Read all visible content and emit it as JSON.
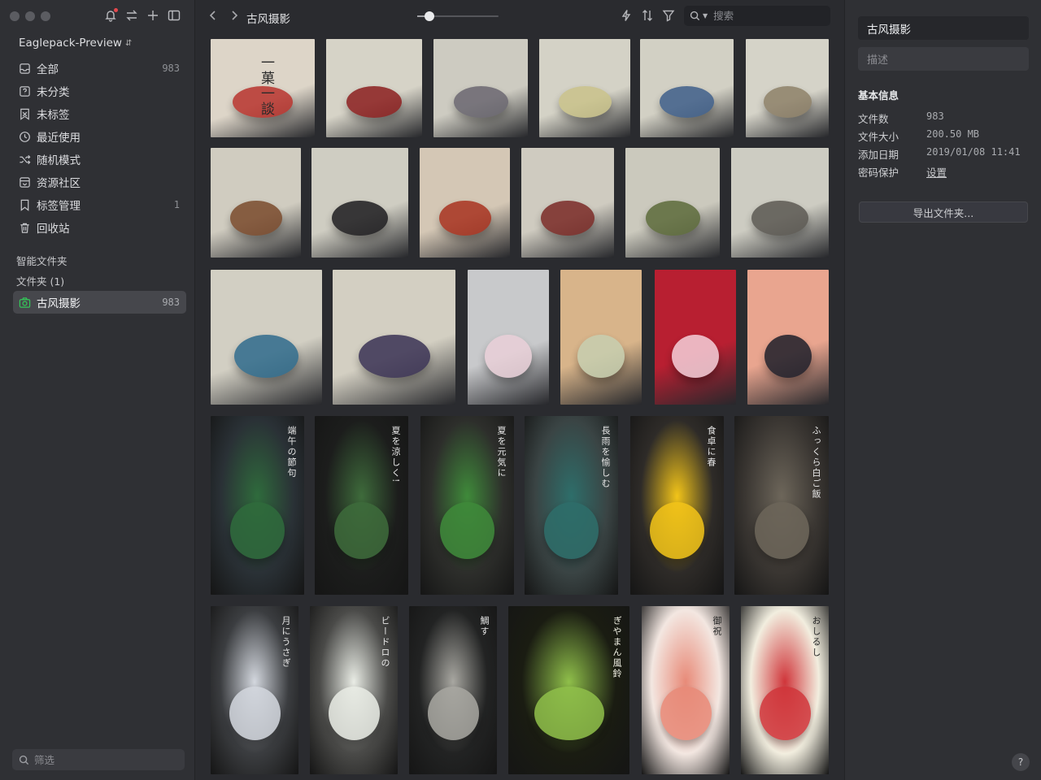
{
  "sidebar": {
    "library_name": "Eaglepack-Preview",
    "items": [
      {
        "label": "全部",
        "count": "983",
        "icon": "inbox-icon"
      },
      {
        "label": "未分类",
        "count": "",
        "icon": "question-box-icon"
      },
      {
        "label": "未标签",
        "count": "",
        "icon": "tag-off-icon"
      },
      {
        "label": "最近使用",
        "count": "",
        "icon": "clock-icon"
      },
      {
        "label": "随机模式",
        "count": "",
        "icon": "shuffle-icon"
      },
      {
        "label": "资源社区",
        "count": "",
        "icon": "community-icon"
      },
      {
        "label": "标签管理",
        "count": "1",
        "icon": "bookmark-icon"
      },
      {
        "label": "回收站",
        "count": "",
        "icon": "trash-icon"
      }
    ],
    "smart_folders_label": "智能文件夹",
    "folders_label": "文件夹 (1)",
    "active_folder": {
      "label": "古风摄影",
      "count": "983"
    },
    "filter_placeholder": "筛选"
  },
  "toolbar": {
    "breadcrumb": "古风摄影",
    "zoom": 0.15,
    "search_placeholder": "搜索"
  },
  "inspector": {
    "title": "古风摄影",
    "description_placeholder": "描述",
    "section_title": "基本信息",
    "rows": [
      {
        "key": "文件数",
        "value": "983"
      },
      {
        "key": "文件大小",
        "value": "200.50 MB"
      },
      {
        "key": "添加日期",
        "value": "2019/01/08 11:41"
      }
    ],
    "password_label": "密码保护",
    "password_link": "设置",
    "export_button": "导出文件夹..."
  },
  "thumbnails": [
    {
      "bg": "#ddd5c8",
      "accent": "#b8332d",
      "text": "一菓一談",
      "tc": "#2a2a2a"
    },
    {
      "bg": "#d6d3c7",
      "accent": "#8b1e1e",
      "text": "",
      "tc": "#333"
    },
    {
      "bg": "#cdcbc1",
      "accent": "#6a6770",
      "text": "",
      "tc": "#333"
    },
    {
      "bg": "#d4d2c6",
      "accent": "#c9c28a",
      "text": "",
      "tc": "#333"
    },
    {
      "bg": "#d2d0c4",
      "accent": "#3f5f8a",
      "text": "",
      "tc": "#333"
    },
    {
      "bg": "#d5d3c8",
      "accent": "#8d8068",
      "text": "",
      "tc": "#333"
    },
    {
      "bg": "#d0ccc0",
      "accent": "#7a4a2c",
      "text": "",
      "tc": "#333"
    },
    {
      "bg": "#cfcdc2",
      "accent": "#1d1c1f",
      "text": "",
      "tc": "#333"
    },
    {
      "bg": "#d4c7b5",
      "accent": "#a8321f",
      "text": "",
      "tc": "#333"
    },
    {
      "bg": "#cfcbc0",
      "accent": "#7a2a26",
      "text": "",
      "tc": "#333"
    },
    {
      "bg": "#cbc9bd",
      "accent": "#5c6a3a",
      "text": "",
      "tc": "#333"
    },
    {
      "bg": "#cdccc2",
      "accent": "#5b5852",
      "text": "",
      "tc": "#333"
    },
    {
      "bg": "#d2cfc3",
      "accent": "#2f6b8c",
      "text": "",
      "tc": "#333"
    },
    {
      "bg": "#d3cfc2",
      "accent": "#3a3254",
      "text": "",
      "tc": "#333"
    },
    {
      "bg": "#c8c9cb",
      "accent": "#e9d0d8",
      "text": "",
      "tc": "#333"
    },
    {
      "bg": "#d8b48a",
      "accent": "#c7cfb0",
      "text": "",
      "tc": "#333"
    },
    {
      "bg": "#b81f31",
      "accent": "#f4d0da",
      "text": "",
      "tc": "#333"
    },
    {
      "bg": "#e9a58f",
      "accent": "#1e1f2a",
      "text": "",
      "tc": "#333"
    },
    {
      "bg": "#2a3136",
      "accent": "#2f6b3c",
      "text": "端午の節句",
      "tc": "#e6e6e6"
    },
    {
      "bg": "#1c1d1c",
      "accent": "#3e6b3b",
      "text": "夏を涼しく!",
      "tc": "#e6e6e6"
    },
    {
      "bg": "#2d2e2b",
      "accent": "#3f8a3a",
      "text": "夏を元気に",
      "tc": "#e6e6e6"
    },
    {
      "bg": "#3a4444",
      "accent": "#2e6e6a",
      "text": "長雨を愉しむ",
      "tc": "#e6e6e6"
    },
    {
      "bg": "#2e2b28",
      "accent": "#f2c419",
      "text": "食卓に春",
      "tc": "#e6e6e6"
    },
    {
      "bg": "#3a3632",
      "accent": "#6d665a",
      "text": "ふっくら白ご飯",
      "tc": "#e6e6e6"
    },
    {
      "bg": "#3b3d40",
      "accent": "#d3d7de",
      "text": "月にうさぎ",
      "tc": "#e6e6e6"
    },
    {
      "bg": "#4a4a48",
      "accent": "#e9ece5",
      "text": "ビードロの",
      "tc": "#e6e6e6"
    },
    {
      "bg": "#222323",
      "accent": "#a8a7a1",
      "text": "鯛す",
      "tc": "#e6e6e6"
    },
    {
      "bg": "#1a1c12",
      "accent": "#8fbf4a",
      "text": "ぎやまん風鈴",
      "tc": "#f3f3e6"
    },
    {
      "bg": "#f3e7e1",
      "accent": "#e88a78",
      "text": "御祝",
      "tc": "#2a2a2a"
    },
    {
      "bg": "#f2eedf",
      "accent": "#d0353a",
      "text": "おしるし",
      "tc": "#2a2a2a"
    }
  ]
}
